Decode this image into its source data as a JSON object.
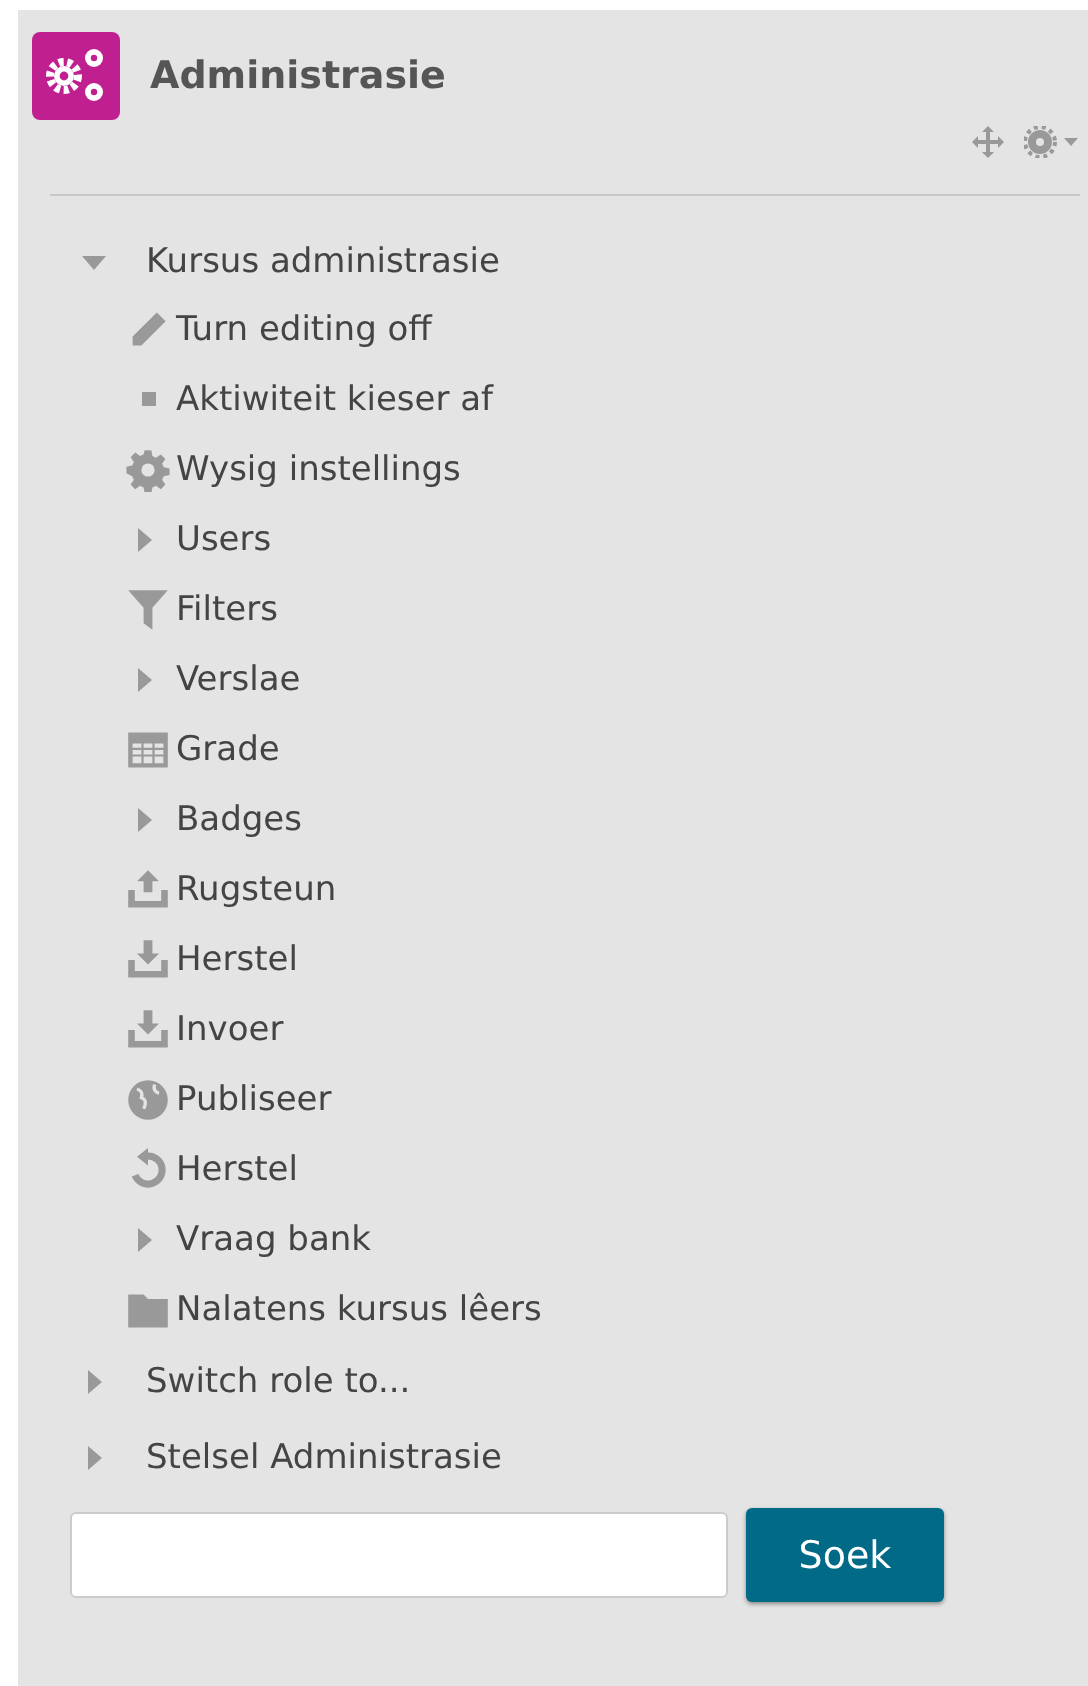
{
  "block": {
    "title": "Administrasie"
  },
  "tree": [
    {
      "label": "Kursus administrasie",
      "kind": "branch",
      "expanded": true,
      "children": [
        {
          "label": "Turn editing off",
          "kind": "pencil"
        },
        {
          "label": "Aktiwiteit kieser af",
          "kind": "bullet"
        },
        {
          "label": "Wysig instellings",
          "kind": "gear"
        },
        {
          "label": "Users",
          "kind": "branch",
          "expanded": false
        },
        {
          "label": "Filters",
          "kind": "filter"
        },
        {
          "label": "Verslae",
          "kind": "branch",
          "expanded": false
        },
        {
          "label": "Grade",
          "kind": "grid"
        },
        {
          "label": "Badges",
          "kind": "branch",
          "expanded": false
        },
        {
          "label": "Rugsteun",
          "kind": "upload"
        },
        {
          "label": "Herstel",
          "kind": "download"
        },
        {
          "label": "Invoer",
          "kind": "download"
        },
        {
          "label": "Publiseer",
          "kind": "globe"
        },
        {
          "label": "Herstel",
          "kind": "refresh"
        },
        {
          "label": "Vraag bank",
          "kind": "branch",
          "expanded": false
        },
        {
          "label": "Nalatens kursus lêers",
          "kind": "folder"
        }
      ]
    },
    {
      "label": "Switch role to...",
      "kind": "branch",
      "expanded": false
    },
    {
      "label": "Stelsel Administrasie",
      "kind": "branch",
      "expanded": false
    }
  ],
  "search": {
    "button": "Soek"
  }
}
